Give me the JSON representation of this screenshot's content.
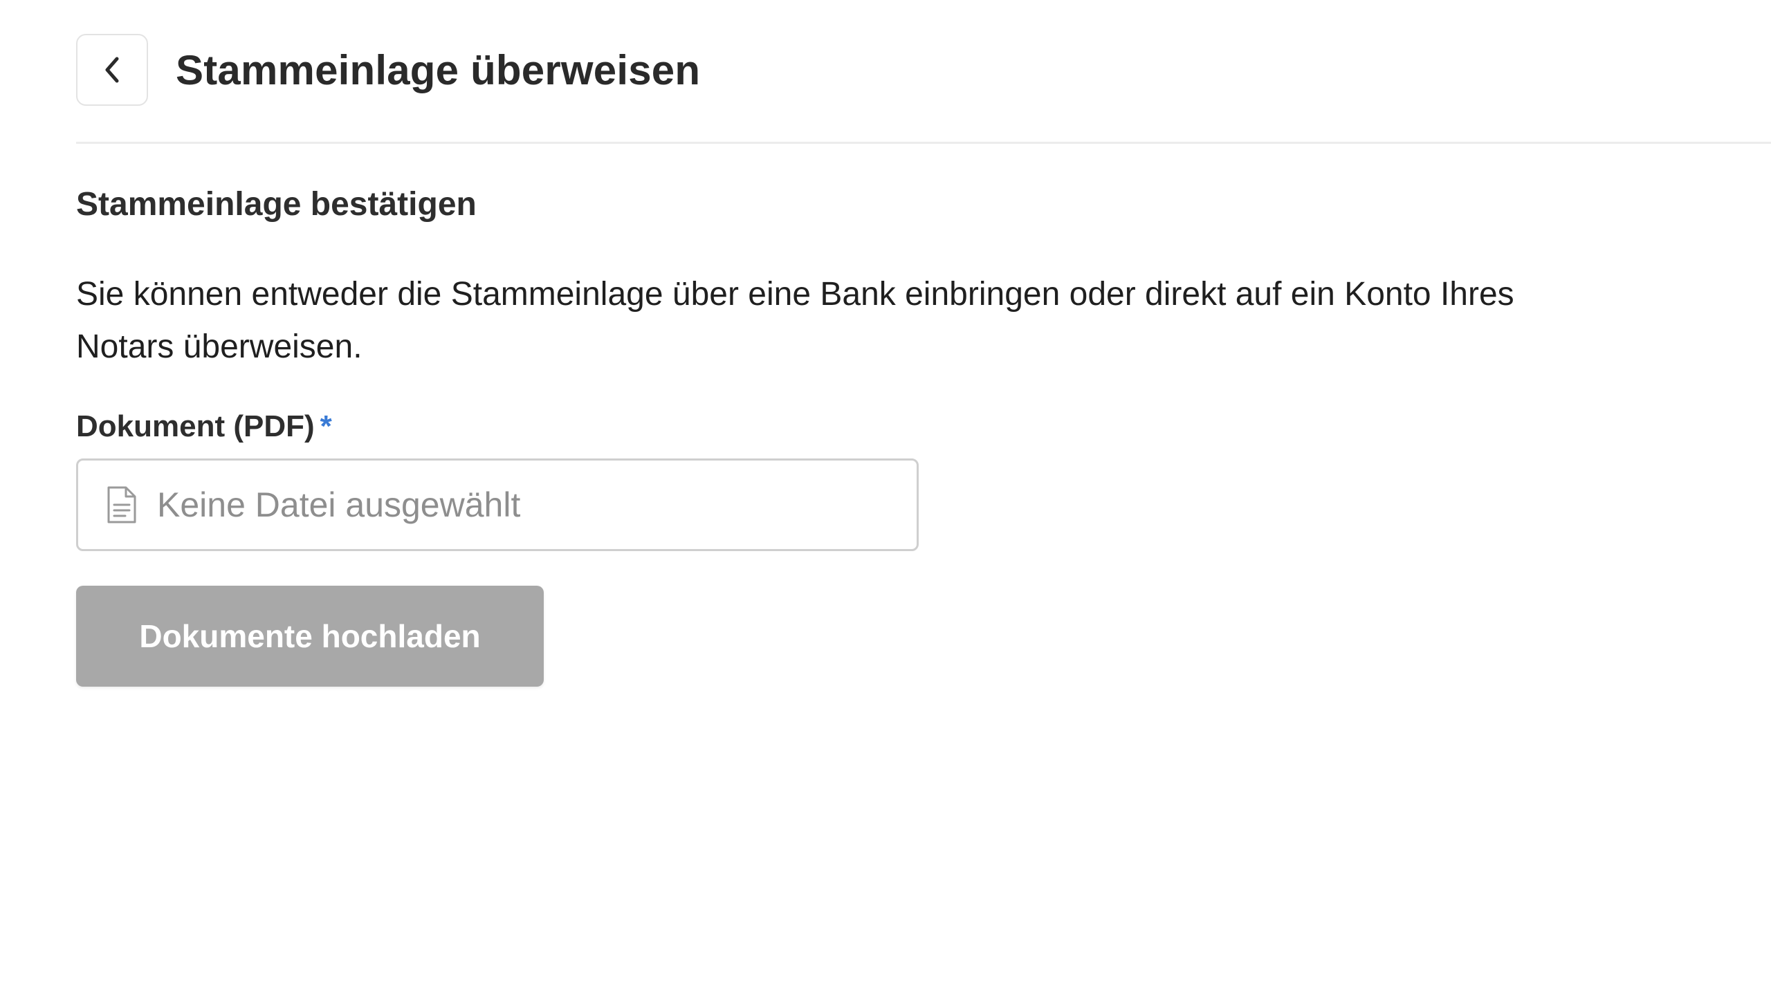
{
  "header": {
    "title": "Stammeinlage überweisen",
    "back_icon": "chevron-left-icon"
  },
  "section": {
    "title": "Stammeinlage bestätigen",
    "description": "Sie können entweder die Stammeinlage über eine Bank einbringen oder direkt auf ein Konto Ihres Notars überweisen."
  },
  "document_field": {
    "label": "Dokument (PDF)",
    "required_marker": "*",
    "placeholder": "Keine Datei ausgewählt",
    "icon": "document-icon"
  },
  "actions": {
    "upload_label": "Dokumente hochladen",
    "upload_disabled": true
  },
  "colors": {
    "required_marker": "#3a7bd5",
    "disabled_button": "#a8a8a8",
    "title_text": "#2a2a2a"
  }
}
